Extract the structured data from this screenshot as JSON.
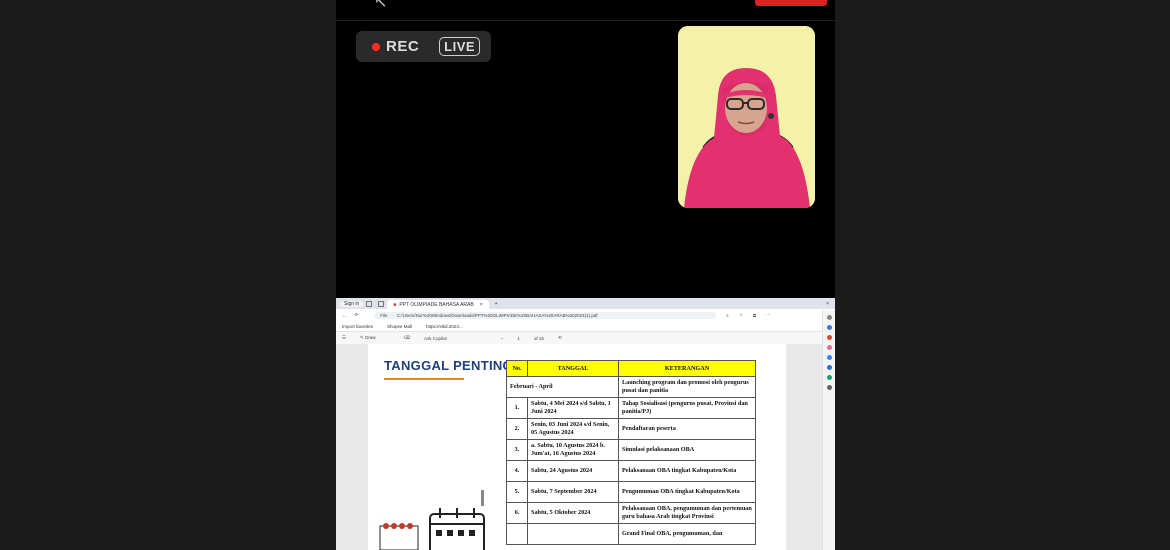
{
  "meeting": {
    "rec_label": "REC",
    "live_label": "LIVE"
  },
  "browser": {
    "tab_title": "PPT OLIMPIADE BAHASA ARAB",
    "signin_label": "Sign in",
    "address": "C:/Users/Nur%20Windows/Downloads/PPT%20OLIMPIADE%20BAHASA%20ARAB%202024(1).pdf",
    "file_prefix": "File",
    "favorites": [
      "Import favorites",
      "Shopee Mall",
      "https://sikd.2023..."
    ],
    "pdf_toolbar": {
      "draw_label": "Draw",
      "ask_label": "Ask Copilot",
      "page_current": "1",
      "page_total": "of 15"
    }
  },
  "document": {
    "heading": "TANGGAL PENTING",
    "table": {
      "headers": [
        "No.",
        "TANGGAL",
        "KETERANGAN"
      ],
      "rows": [
        {
          "no": "",
          "tanggal": "Februari - April",
          "keterangan": "Launching program dan promosi oleh pengurus pusat dan panitia",
          "merged": true
        },
        {
          "no": "1.",
          "tanggal": "Sabtu, 4 Mei 2024 s/d Sabtu, 1 Juni 2024",
          "keterangan": "Tahap Sosialisasi (pengurus pusat, Provinsi dan panitia/PJ)"
        },
        {
          "no": "2.",
          "tanggal": "Senin, 03 Juni 2024 s/d Senin, 05 Agustus 2024",
          "keterangan": "Pendaftaran peserta"
        },
        {
          "no": "3.",
          "tanggal": "a. Sabtu, 10 Agustus 2024 b. Jum'at, 16 Agustus 2024",
          "keterangan": "Simulasi pelaksanaan OBA"
        },
        {
          "no": "4.",
          "tanggal": "Sabtu, 24 Agustus 2024",
          "keterangan": "Pelaksanaan OBA tingkat Kabupaten/Kota"
        },
        {
          "no": "5.",
          "tanggal": "Sabtu, 7 September 2024",
          "keterangan": "Pengumuman OBA tingkat Kabupaten/Kota"
        },
        {
          "no": "6.",
          "tanggal": "Sabtu, 5 Oktober 2024",
          "keterangan": "Pelaksanaan OBA, pengumuman dan pertemuan guru bahasa Arab tingkat Provinsi"
        },
        {
          "no": "",
          "tanggal": "",
          "keterangan": "Grand Final OBA, pengumuman, dan"
        }
      ]
    }
  },
  "colors": {
    "header_yellow": "#ffff00",
    "heading_blue": "#1f3f7a",
    "rec_red": "#ff2b2b",
    "camera_bg": "#f3f2a8",
    "hijab_pink": "#e3306f"
  }
}
